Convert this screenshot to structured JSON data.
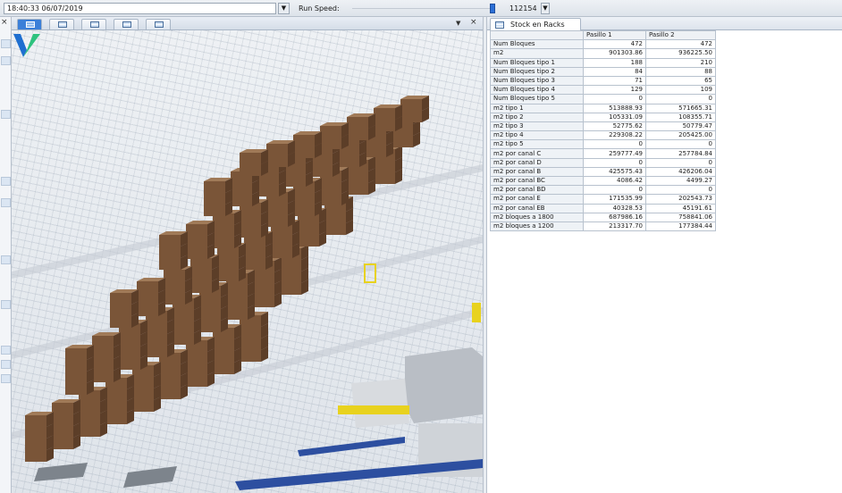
{
  "toolbar": {
    "datetime": "18:40:33 06/07/2019",
    "run_speed_label": "Run Speed:",
    "run_speed_value": "112154",
    "run_speed_fraction": 0.98
  },
  "left_panel": {
    "close_glyph": "×"
  },
  "view_tabs": {
    "tabs": [
      {
        "icon": "3d-view-icon",
        "active": true
      },
      {
        "icon": "table-icon",
        "active": false
      },
      {
        "icon": "table-icon",
        "active": false
      },
      {
        "icon": "table-icon",
        "active": false
      },
      {
        "icon": "table-icon",
        "active": false
      }
    ],
    "menu_glyph": "▼",
    "close_glyph": "×"
  },
  "right_panel": {
    "tab_label": "Stock en Racks",
    "table": {
      "headers": [
        "",
        "Pasillo 1",
        "Pasillo 2"
      ],
      "rows": [
        [
          "Num Bloques",
          "472",
          "472"
        ],
        [
          "m2",
          "901303.86",
          "936225.50"
        ],
        [
          "Num Bloques tipo 1",
          "188",
          "210"
        ],
        [
          "Num Bloques tipo 2",
          "84",
          "88"
        ],
        [
          "Num Bloques tipo 3",
          "71",
          "65"
        ],
        [
          "Num Bloques tipo 4",
          "129",
          "109"
        ],
        [
          "Num Bloques tipo 5",
          "0",
          "0"
        ],
        [
          "m2 tipo 1",
          "513888.93",
          "571665.31"
        ],
        [
          "m2 tipo 2",
          "105331.09",
          "108355.71"
        ],
        [
          "m2 tipo 3",
          "52775.62",
          "50779.47"
        ],
        [
          "m2 tipo 4",
          "229308.22",
          "205425.00"
        ],
        [
          "m2 tipo 5",
          "0",
          "0"
        ],
        [
          "m2 por canal C",
          "259777.49",
          "257784.84"
        ],
        [
          "m2 por canal D",
          "0",
          "0"
        ],
        [
          "m2 por canal B",
          "425575.43",
          "426206.04"
        ],
        [
          "m2 por canal BC",
          "4086.42",
          "4499.27"
        ],
        [
          "m2 por canal BD",
          "0",
          "0"
        ],
        [
          "m2 por canal E",
          "171535.99",
          "202543.73"
        ],
        [
          "m2 por canal EB",
          "40328.53",
          "45191.61"
        ],
        [
          "m2 bloques a 1800",
          "687986.16",
          "758841.06"
        ],
        [
          "m2 bloques a 1200",
          "213317.70",
          "177384.44"
        ]
      ]
    }
  },
  "colors": {
    "box_front": "#7a5538",
    "box_top": "#a07a58",
    "box_side": "#5c3e28",
    "rack_blue": "#2d4fa0",
    "machine_yellow": "#e8d21e",
    "logo_blue": "#1f6fd0",
    "logo_green": "#2ec27e"
  }
}
